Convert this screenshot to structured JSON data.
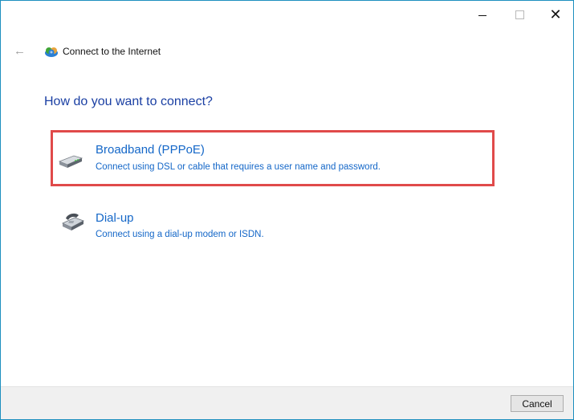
{
  "window": {
    "title": "Connect to the Internet",
    "controls": {
      "minimize": "minimize",
      "maximize": "maximize",
      "close": "close"
    }
  },
  "nav": {
    "back_icon": "back-arrow-icon",
    "app_icon": "network-globe-icon"
  },
  "heading": "How do you want to connect?",
  "options": [
    {
      "title": "Broadband (PPPoE)",
      "description": "Connect using DSL or cable that requires a user name and password.",
      "icon": "broadband-modem-icon",
      "highlighted": true
    },
    {
      "title": "Dial-up",
      "description": "Connect using a dial-up modem or ISDN.",
      "icon": "dialup-phone-icon",
      "highlighted": false
    }
  ],
  "footer": {
    "cancel_label": "Cancel"
  },
  "colors": {
    "link": "#1467c8",
    "heading": "#1a3fa3",
    "highlight_border": "#e04a4a",
    "window_border": "#1d8fbf"
  }
}
